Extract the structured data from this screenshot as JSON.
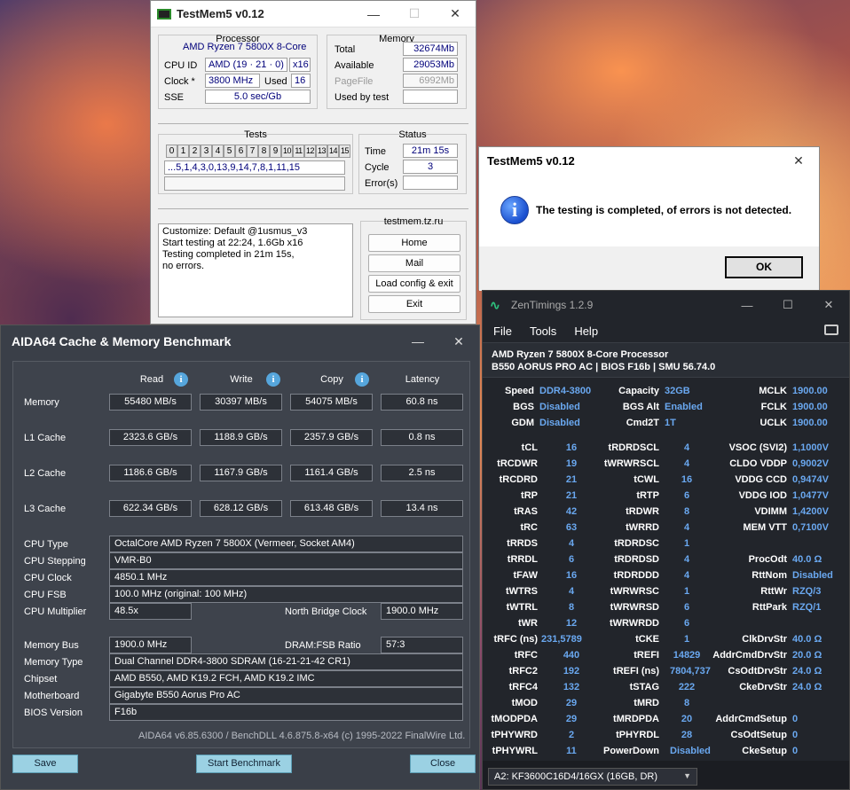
{
  "testmem": {
    "title": "TestMem5 v0.12",
    "processor_label": "Processor",
    "cpu_name": "AMD Ryzen 7 5800X 8-Core",
    "cpu_id_label": "CPU ID",
    "cpu_id_value": "AMD  (19 · 21 · 0)",
    "cpu_threads": "x16",
    "clock_label": "Clock *",
    "clock_value": "3800 MHz",
    "used_label": "Used",
    "used_value": "16",
    "sse_label": "SSE",
    "sse_value": "5.0 sec/Gb",
    "memory_label": "Memory",
    "total_label": "Total",
    "total_value": "32674Mb",
    "available_label": "Available",
    "available_value": "29053Mb",
    "pagefile_label": "PageFile",
    "pagefile_value": "6992Mb",
    "usedbytest_label": "Used by test",
    "usedbytest_value": "",
    "tests_label": "Tests",
    "test_numbers": [
      "0",
      "1",
      "2",
      "3",
      "4",
      "5",
      "6",
      "7",
      "8",
      "9",
      "10",
      "11",
      "12",
      "13",
      "14",
      "15"
    ],
    "test_sequence": "...5,1,4,3,0,13,9,14,7,8,1,11,15",
    "status_label": "Status",
    "time_label": "Time",
    "time_value": "21m 15s",
    "cycle_label": "Cycle",
    "cycle_value": "3",
    "errors_label": "Error(s)",
    "errors_value": "",
    "log_lines": [
      "Customize: Default @1usmus_v3",
      "Start testing at 22:24, 1.6Gb x16",
      "Testing completed in 21m 15s,",
      "no errors."
    ],
    "site_label": "testmem.tz.ru",
    "btn_home": "Home",
    "btn_mail": "Mail",
    "btn_load": "Load config & exit",
    "btn_exit": "Exit"
  },
  "dialog": {
    "title": "TestMem5 v0.12",
    "message": "The testing is completed, of errors is not detected.",
    "ok": "OK"
  },
  "aida": {
    "title": "AIDA64 Cache & Memory Benchmark",
    "headers": [
      "Read",
      "Write",
      "Copy",
      "Latency"
    ],
    "rows": [
      {
        "label": "Memory",
        "read": "55480 MB/s",
        "write": "30397 MB/s",
        "copy": "54075 MB/s",
        "latency": "60.8 ns"
      },
      {
        "label": "L1 Cache",
        "read": "2323.6 GB/s",
        "write": "1188.9 GB/s",
        "copy": "2357.9 GB/s",
        "latency": "0.8 ns"
      },
      {
        "label": "L2 Cache",
        "read": "1186.6 GB/s",
        "write": "1167.9 GB/s",
        "copy": "1161.4 GB/s",
        "latency": "2.5 ns"
      },
      {
        "label": "L3 Cache",
        "read": "622.34 GB/s",
        "write": "628.12 GB/s",
        "copy": "613.48 GB/s",
        "latency": "13.4 ns"
      }
    ],
    "cpu_type_label": "CPU Type",
    "cpu_type": "OctalCore AMD Ryzen 7 5800X  (Vermeer, Socket AM4)",
    "cpu_stepping_label": "CPU Stepping",
    "cpu_stepping": "VMR-B0",
    "cpu_clock_label": "CPU Clock",
    "cpu_clock": "4850.1 MHz",
    "cpu_fsb_label": "CPU FSB",
    "cpu_fsb": "100.0 MHz  (original: 100 MHz)",
    "cpu_mult_label": "CPU Multiplier",
    "cpu_mult": "48.5x",
    "nb_clock_label": "North Bridge Clock",
    "nb_clock": "1900.0 MHz",
    "mem_bus_label": "Memory Bus",
    "mem_bus": "1900.0 MHz",
    "dram_ratio_label": "DRAM:FSB Ratio",
    "dram_ratio": "57:3",
    "mem_type_label": "Memory Type",
    "mem_type": "Dual Channel DDR4-3800 SDRAM  (16-21-21-42 CR1)",
    "chipset_label": "Chipset",
    "chipset": "AMD B550, AMD K19.2 FCH, AMD K19.2 IMC",
    "mobo_label": "Motherboard",
    "mobo": "Gigabyte B550 Aorus Pro AC",
    "bios_label": "BIOS Version",
    "bios": "F16b",
    "footer": "AIDA64 v6.85.6300 / BenchDLL 4.6.875.8-x64  (c) 1995-2022 FinalWire Ltd.",
    "btn_save": "Save",
    "btn_start": "Start Benchmark",
    "btn_close": "Close"
  },
  "zen": {
    "title": "ZenTimings 1.2.9",
    "menu": [
      "File",
      "Tools",
      "Help"
    ],
    "cpu": "AMD Ryzen 7 5800X 8-Core Processor",
    "board": "B550 AORUS PRO AC | BIOS F16b | SMU 56.74.0",
    "top": [
      [
        [
          "Speed",
          "DDR4-3800"
        ],
        [
          "Capacity",
          "32GB"
        ],
        [
          "MCLK",
          "1900.00"
        ]
      ],
      [
        [
          "BGS",
          "Disabled"
        ],
        [
          "BGS Alt",
          "Enabled"
        ],
        [
          "FCLK",
          "1900.00"
        ]
      ],
      [
        [
          "GDM",
          "Disabled"
        ],
        [
          "Cmd2T",
          "1T"
        ],
        [
          "UCLK",
          "1900.00"
        ]
      ]
    ],
    "timings": [
      [
        [
          "tCL",
          "16"
        ],
        [
          "tRDRDSCL",
          "4"
        ],
        [
          "VSOC (SVI2)",
          "1,1000V"
        ]
      ],
      [
        [
          "tRCDWR",
          "19"
        ],
        [
          "tWRWRSCL",
          "4"
        ],
        [
          "CLDO VDDP",
          "0,9002V"
        ]
      ],
      [
        [
          "tRCDRD",
          "21"
        ],
        [
          "tCWL",
          "16"
        ],
        [
          "VDDG CCD",
          "0,9474V"
        ]
      ],
      [
        [
          "tRP",
          "21"
        ],
        [
          "tRTP",
          "6"
        ],
        [
          "VDDG IOD",
          "1,0477V"
        ]
      ],
      [
        [
          "tRAS",
          "42"
        ],
        [
          "tRDWR",
          "8"
        ],
        [
          "VDIMM",
          "1,4200V"
        ]
      ],
      [
        [
          "tRC",
          "63"
        ],
        [
          "tWRRD",
          "4"
        ],
        [
          "MEM VTT",
          "0,7100V"
        ]
      ],
      [
        [
          "tRRDS",
          "4"
        ],
        [
          "tRDRDSC",
          "1"
        ],
        [
          "",
          ""
        ]
      ],
      [
        [
          "tRRDL",
          "6"
        ],
        [
          "tRDRDSD",
          "4"
        ],
        [
          "ProcOdt",
          "40.0 Ω"
        ]
      ],
      [
        [
          "tFAW",
          "16"
        ],
        [
          "tRDRDDD",
          "4"
        ],
        [
          "RttNom",
          "Disabled"
        ]
      ],
      [
        [
          "tWTRS",
          "4"
        ],
        [
          "tWRWRSC",
          "1"
        ],
        [
          "RttWr",
          "RZQ/3"
        ]
      ],
      [
        [
          "tWTRL",
          "8"
        ],
        [
          "tWRWRSD",
          "6"
        ],
        [
          "RttPark",
          "RZQ/1"
        ]
      ],
      [
        [
          "tWR",
          "12"
        ],
        [
          "tWRWRDD",
          "6"
        ],
        [
          "",
          ""
        ]
      ],
      [
        [
          "tRFC (ns)",
          "231,5789"
        ],
        [
          "tCKE",
          "1"
        ],
        [
          "ClkDrvStr",
          "40.0 Ω"
        ]
      ],
      [
        [
          "tRFC",
          "440"
        ],
        [
          "tREFI",
          "14829"
        ],
        [
          "AddrCmdDrvStr",
          "20.0 Ω"
        ]
      ],
      [
        [
          "tRFC2",
          "192"
        ],
        [
          "tREFI (ns)",
          "7804,737"
        ],
        [
          "CsOdtDrvStr",
          "24.0 Ω"
        ]
      ],
      [
        [
          "tRFC4",
          "132"
        ],
        [
          "tSTAG",
          "222"
        ],
        [
          "CkeDrvStr",
          "24.0 Ω"
        ]
      ],
      [
        [
          "tMOD",
          "29"
        ],
        [
          "tMRD",
          "8"
        ],
        [
          "",
          ""
        ]
      ],
      [
        [
          "tMODPDA",
          "29"
        ],
        [
          "tMRDPDA",
          "20"
        ],
        [
          "AddrCmdSetup",
          "0"
        ]
      ],
      [
        [
          "tPHYWRD",
          "2"
        ],
        [
          "tPHYRDL",
          "28"
        ],
        [
          "CsOdtSetup",
          "0"
        ]
      ],
      [
        [
          "tPHYWRL",
          "11"
        ],
        [
          "PowerDown",
          "Disabled"
        ],
        [
          "CkeSetup",
          "0"
        ]
      ]
    ],
    "module": "A2: KF3600C16D4/16GX (16GB, DR)"
  }
}
